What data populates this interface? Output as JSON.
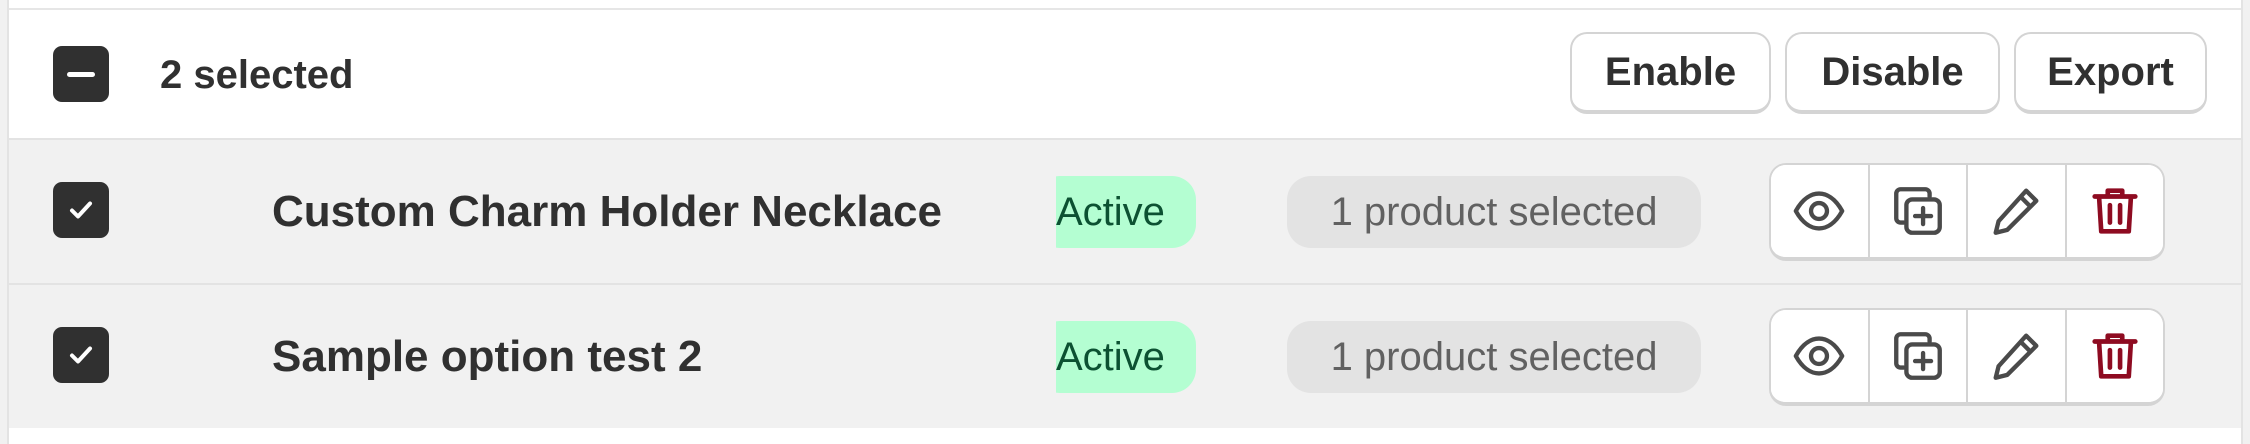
{
  "bulk": {
    "selected_label": "2 selected",
    "actions": {
      "enable": "Enable",
      "disable": "Disable",
      "export": "Export"
    }
  },
  "rows": [
    {
      "name": "Custom Charm Holder Necklace",
      "status": "Active",
      "products": "1 product selected",
      "checked": true
    },
    {
      "name": "Sample option test 2",
      "status": "Active",
      "products": "1 product selected",
      "checked": true
    }
  ],
  "row_actions": [
    "view-icon",
    "duplicate-icon",
    "edit-icon",
    "delete-icon"
  ],
  "colors": {
    "checkbox": "#303030",
    "status_bg": "#b4fed2",
    "status_text": "#0c5132",
    "delete": "#8e0b21",
    "badge_bg": "#e3e3e3"
  }
}
